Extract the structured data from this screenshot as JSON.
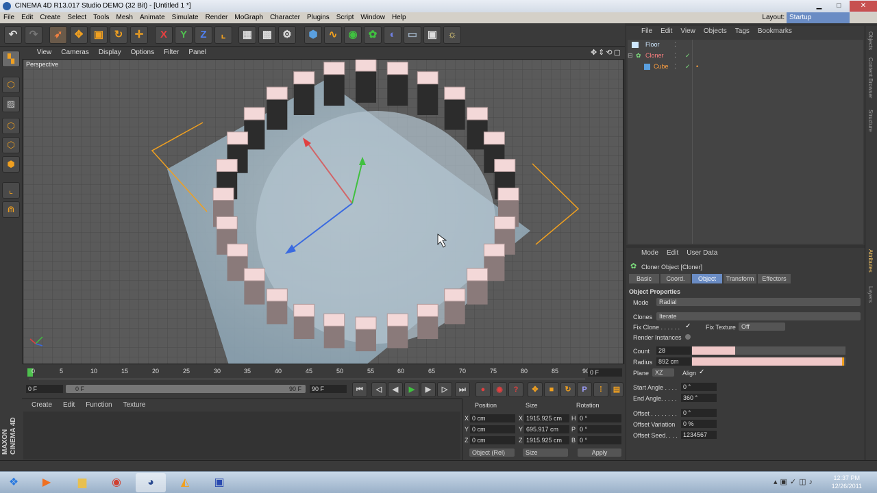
{
  "window": {
    "title": "CINEMA 4D R13.017 Studio DEMO (32 Bit) - [Untitled 1 *]"
  },
  "menubar": {
    "items": [
      "File",
      "Edit",
      "Create",
      "Select",
      "Tools",
      "Mesh",
      "Animate",
      "Simulate",
      "Render",
      "MoGraph",
      "Character",
      "Plugins",
      "Script",
      "Window",
      "Help"
    ],
    "layout_label": "Layout:",
    "layout_value": "Startup"
  },
  "viewport": {
    "menu": [
      "View",
      "Cameras",
      "Display",
      "Options",
      "Filter",
      "Panel"
    ],
    "label": "Perspective",
    "clone_count": 28
  },
  "timeline": {
    "ticks": [
      "0",
      "5",
      "10",
      "15",
      "20",
      "25",
      "30",
      "35",
      "40",
      "45",
      "50",
      "55",
      "60",
      "65",
      "70",
      "75",
      "80",
      "85",
      "90"
    ],
    "frame_field": "0 F"
  },
  "transport": {
    "start": "0 F",
    "slider_left": "0 F",
    "slider_right": "90 F",
    "end": "90 F"
  },
  "material": {
    "menu": [
      "Create",
      "Edit",
      "Function",
      "Texture"
    ]
  },
  "coords": {
    "headers": [
      "Position",
      "Size",
      "Rotation"
    ],
    "rows": [
      {
        "axis": "X",
        "pos": "0 cm",
        "size_axis": "X",
        "size": "1915.925 cm",
        "rot_axis": "H",
        "rot": "0 °"
      },
      {
        "axis": "Y",
        "pos": "0 cm",
        "size_axis": "Y",
        "size": "695.917 cm",
        "rot_axis": "P",
        "rot": "0 °"
      },
      {
        "axis": "Z",
        "pos": "0 cm",
        "size_axis": "Z",
        "size": "1915.925 cm",
        "rot_axis": "B",
        "rot": "0 °"
      }
    ],
    "mode": "Object (Rel)",
    "size_mode": "Size",
    "apply": "Apply"
  },
  "objects": {
    "menu": [
      "File",
      "Edit",
      "View",
      "Objects",
      "Tags",
      "Bookmarks"
    ],
    "list": [
      {
        "name": "Floor",
        "color": "#cfe8ff"
      },
      {
        "name": "Cloner",
        "color": "#7ee07e"
      },
      {
        "name": "Cube",
        "color": "#ffa040"
      }
    ]
  },
  "attributes": {
    "menu": [
      "Mode",
      "Edit",
      "User Data"
    ],
    "object_title": "Cloner Object [Cloner]",
    "tabs": [
      "Basic",
      "Coord.",
      "Object",
      "Transform",
      "Effectors"
    ],
    "active_tab": "Object",
    "section": "Object Properties",
    "mode_label": "Mode",
    "mode_value": "Radial",
    "clones_label": "Clones",
    "clones_value": "Iterate",
    "fix_clone_label": "Fix Clone . . . . . .",
    "fix_texture_label": "Fix Texture",
    "fix_texture_value": "Off",
    "render_instances_label": "Render Instances",
    "count_label": "Count",
    "count_value": "28",
    "count_fill": 0.28,
    "radius_label": "Radius",
    "radius_value": "892 cm",
    "radius_fill": 0.99,
    "plane_label": "Plane",
    "plane_value": "XZ",
    "align_label": "Align",
    "start_angle_label": "Start Angle . . . .",
    "start_angle_value": "0 °",
    "end_angle_label": "End Angle. . . . .",
    "end_angle_value": "360 °",
    "offset_label": "Offset . . . . . . . .",
    "offset_value": "0 °",
    "offset_var_label": "Offset Variation",
    "offset_var_value": "0 %",
    "offset_seed_label": "Offset Seed. . . .",
    "offset_seed_value": "1234567"
  },
  "right_strip": [
    "Objects",
    "Content Browser",
    "Structure",
    "Attributes",
    "Layers"
  ],
  "branding": {
    "line1": "MAXON",
    "line2": "CINEMA 4D"
  },
  "clock": {
    "time": "12:37 PM",
    "date": "12/26/2011"
  }
}
